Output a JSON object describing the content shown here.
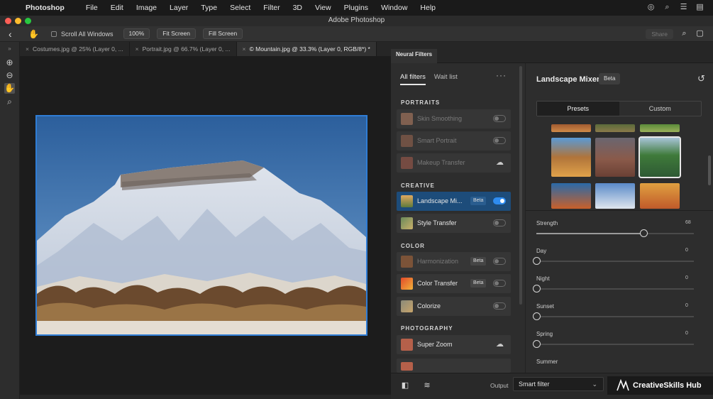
{
  "menubar": {
    "app_name": "Photoshop",
    "items": [
      "File",
      "Edit",
      "Image",
      "Layer",
      "Type",
      "Select",
      "Filter",
      "3D",
      "View",
      "Plugins",
      "Window",
      "Help"
    ]
  },
  "window": {
    "title": "Adobe Photoshop"
  },
  "options_bar": {
    "scroll_all_windows": "Scroll All Windows",
    "zoom_100": "100%",
    "fit_screen": "Fit Screen",
    "fill_screen": "Fill Screen",
    "share": "Share"
  },
  "doc_tabs": [
    {
      "label": "Costumes.jpg @ 25% (Layer 0, ...",
      "active": false
    },
    {
      "label": "Portrait.jpg @ 66.7% (Layer 0, ...",
      "active": false
    },
    {
      "label": "© Mountain.jpg @ 33.3% (Layer 0, RGB/8*) *",
      "active": true
    }
  ],
  "neural_filters": {
    "panel_tab": "Neural Filters",
    "list_tabs": {
      "all": "All filters",
      "wait": "Wait list"
    },
    "sections": {
      "portraits": "PORTRAITS",
      "creative": "CREATIVE",
      "color": "COLOR",
      "photography": "PHOTOGRAPHY"
    },
    "filters": {
      "skin_smoothing": "Skin Smoothing",
      "smart_portrait": "Smart Portrait",
      "makeup_transfer": "Makeup Transfer",
      "landscape_mixer": "Landscape Mi...",
      "style_transfer": "Style Transfer",
      "harmonization": "Harmonization",
      "color_transfer": "Color Transfer",
      "colorize": "Colorize",
      "super_zoom": "Super Zoom"
    },
    "beta": "Beta"
  },
  "landscape_mixer": {
    "title": "Landscape Mixer",
    "beta": "Beta",
    "tabs": {
      "presets": "Presets",
      "custom": "Custom"
    },
    "sliders": [
      {
        "name": "Strength",
        "value": "68",
        "level": 0.68
      },
      {
        "name": "Day",
        "value": "0",
        "level": 0
      },
      {
        "name": "Night",
        "value": "0",
        "level": 0
      },
      {
        "name": "Sunset",
        "value": "0",
        "level": 0
      },
      {
        "name": "Spring",
        "value": "0",
        "level": 0
      },
      {
        "name": "Summer",
        "value": "",
        "level": 0
      }
    ]
  },
  "bottom": {
    "output_label": "Output",
    "output_value": "Smart filter"
  },
  "watermark": "CreativeSkills Hub",
  "colors": {
    "accent": "#2f8cf0",
    "selection": "#1d4c7a",
    "canvas_border": "#2f7dd6"
  }
}
